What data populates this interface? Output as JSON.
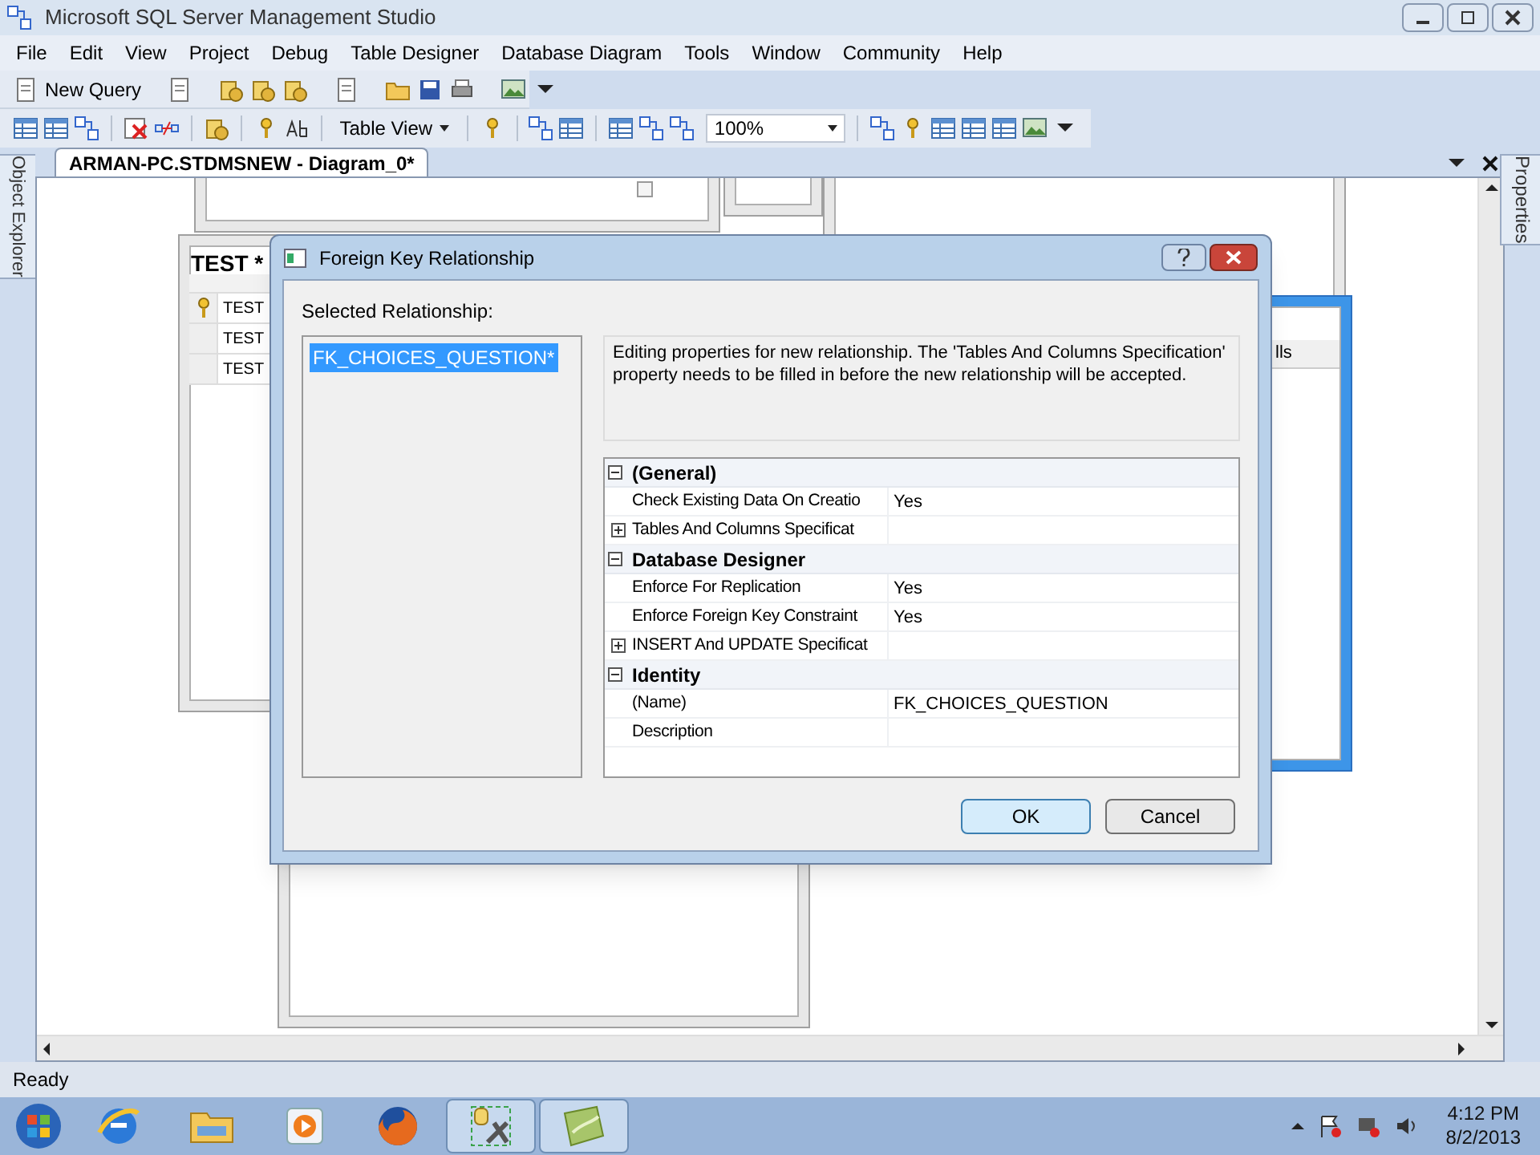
{
  "window": {
    "title": "Microsoft SQL Server Management Studio"
  },
  "menu": [
    "File",
    "Edit",
    "View",
    "Project",
    "Debug",
    "Table Designer",
    "Database Diagram",
    "Tools",
    "Window",
    "Community",
    "Help"
  ],
  "toolbar_1": {
    "new_query": "New Query"
  },
  "toolbar_2": {
    "view_menu": "Table View",
    "zoom": "100%"
  },
  "side_tabs": {
    "left": "Object Explorer",
    "right": "Properties"
  },
  "document_tab": {
    "title": "ARMAN-PC.STDMSNEW - Diagram_0*"
  },
  "diagram": {
    "test_table": {
      "title": "TEST *",
      "rows": [
        {
          "text": "TEST",
          "key": true
        },
        {
          "text": "TEST",
          "key": false
        },
        {
          "text": "TEST",
          "key": false
        }
      ]
    },
    "selected_table": {
      "column_header": "lls"
    }
  },
  "dialog": {
    "title": "Foreign Key Relationship",
    "list_label": "Selected Relationship:",
    "relationships": [
      {
        "text": "FK_CHOICES_QUESTION*",
        "selected": true
      }
    ],
    "description": "Editing properties for new relationship.  The 'Tables And Columns Specification' property needs to be filled in before the new relationship will be accepted.",
    "categories": [
      {
        "name": "(General)",
        "expanded": true,
        "children": [
          {
            "name": "Check Existing Data On Creatio",
            "value": "Yes",
            "kind": "plain"
          },
          {
            "name": "Tables And Columns Specificat",
            "kind": "collapsible",
            "expanded": false
          }
        ]
      },
      {
        "name": "Database Designer",
        "expanded": true,
        "children": [
          {
            "name": "Enforce For Replication",
            "value": "Yes",
            "kind": "plain"
          },
          {
            "name": "Enforce Foreign Key Constraint",
            "value": "Yes",
            "kind": "plain"
          },
          {
            "name": "INSERT And UPDATE Specificat",
            "kind": "collapsible",
            "expanded": false
          }
        ]
      },
      {
        "name": "Identity",
        "expanded": true,
        "children": [
          {
            "name": "(Name)",
            "value": "FK_CHOICES_QUESTION",
            "kind": "plain"
          },
          {
            "name": "Description",
            "kind": "plain"
          }
        ]
      }
    ],
    "buttons": [
      {
        "label": "OK",
        "focused": true
      },
      {
        "label": "Cancel",
        "focused": false
      }
    ]
  },
  "status_bar": "Ready",
  "taskbar": {
    "apps": [
      {
        "kind": "browser",
        "running": false
      },
      {
        "kind": "folder",
        "running": false
      },
      {
        "kind": "media",
        "running": false
      },
      {
        "kind": "firefox",
        "running": false
      },
      {
        "kind": "ssms",
        "running": true
      },
      {
        "kind": "notes",
        "running": true
      }
    ],
    "time": "4:12 PM",
    "date": "8/2/2013"
  }
}
